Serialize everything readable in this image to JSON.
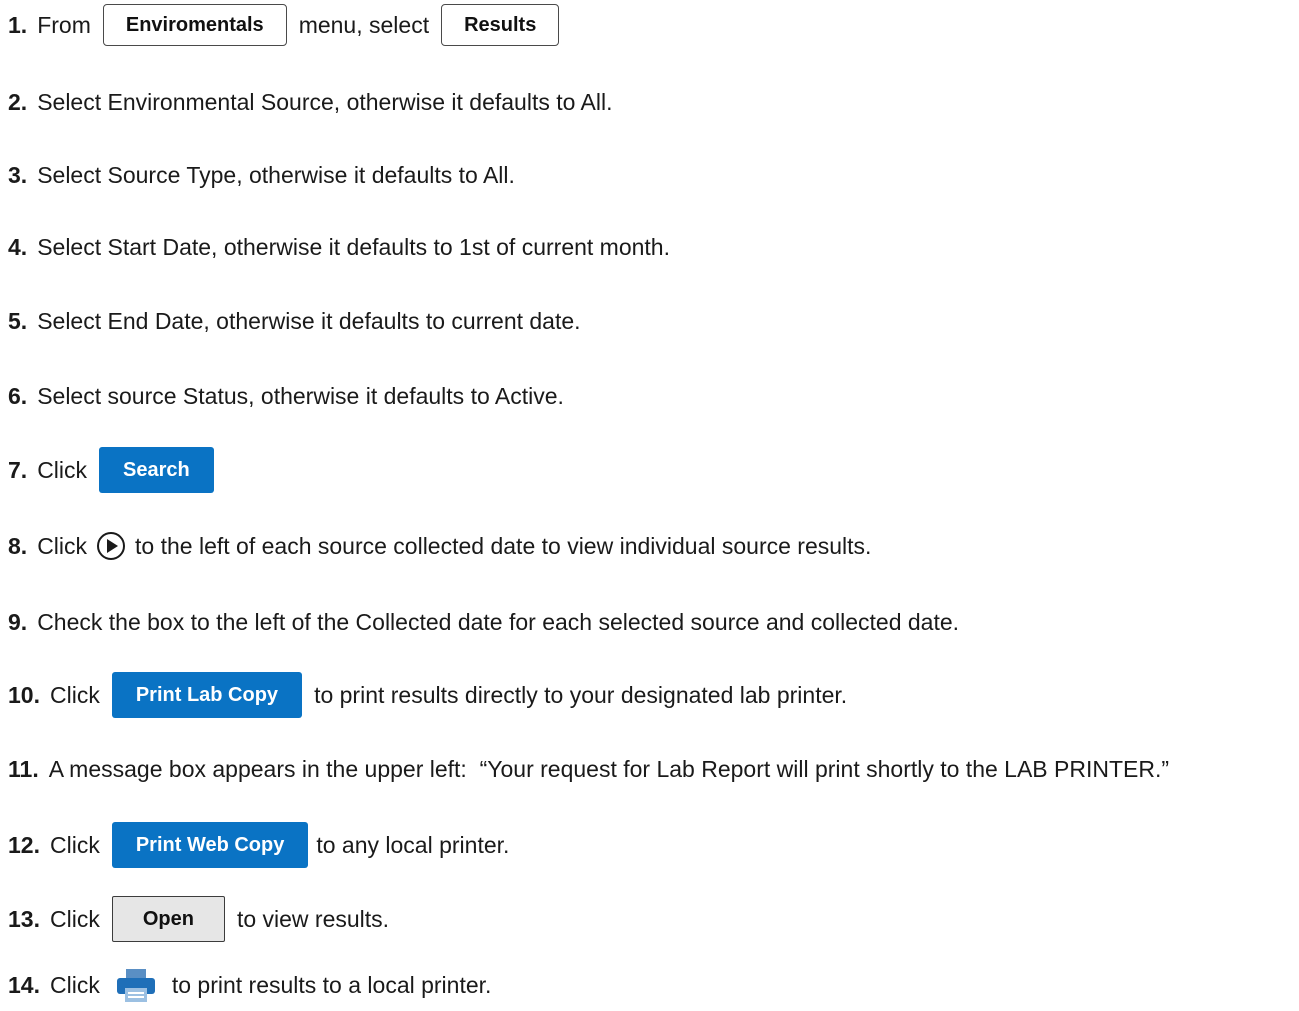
{
  "steps": [
    {
      "num": "1.",
      "t1": "From",
      "btn1": "Enviromentals",
      "t2": "menu, select",
      "btn2": "Results"
    },
    {
      "num": "2.",
      "text": "Select Environmental Source, otherwise it defaults to All."
    },
    {
      "num": "3.",
      "text": "Select Source Type, otherwise it defaults to All."
    },
    {
      "num": "4.",
      "text": "Select Start Date, otherwise it defaults to 1st of current month."
    },
    {
      "num": "5.",
      "text": "Select End Date, otherwise it defaults to current date."
    },
    {
      "num": "6.",
      "text": "Select source Status, otherwise it defaults to Active."
    },
    {
      "num": "7.",
      "t1": "Click",
      "btn": "Search"
    },
    {
      "num": "8.",
      "t1": "Click",
      "icon": "play-circle-icon",
      "t2": "to the left of each source collected date to view individual source results."
    },
    {
      "num": "9.",
      "text": "Check the box to the left of the Collected date for each selected source and collected date."
    },
    {
      "num": "10.",
      "t1": "Click",
      "btn": "Print Lab Copy",
      "t2": "to print results directly to your designated lab printer."
    },
    {
      "num": "11.",
      "text": "A message box appears in the upper left:  “Your request for Lab Report will print shortly to the LAB PRINTER.”"
    },
    {
      "num": "12.",
      "t1": "Click",
      "btn": "Print Web Copy",
      "t2": "to any local printer."
    },
    {
      "num": "13.",
      "t1": "Click",
      "btn": "Open",
      "t2": "to view results."
    },
    {
      "num": "14.",
      "t1": "Click",
      "icon": "printer-icon",
      "t2": "to print results to a local printer."
    }
  ],
  "colors": {
    "primary_button": "#0a73c4",
    "secondary_button": "#e6e6e6",
    "text": "#1a1a1a"
  }
}
